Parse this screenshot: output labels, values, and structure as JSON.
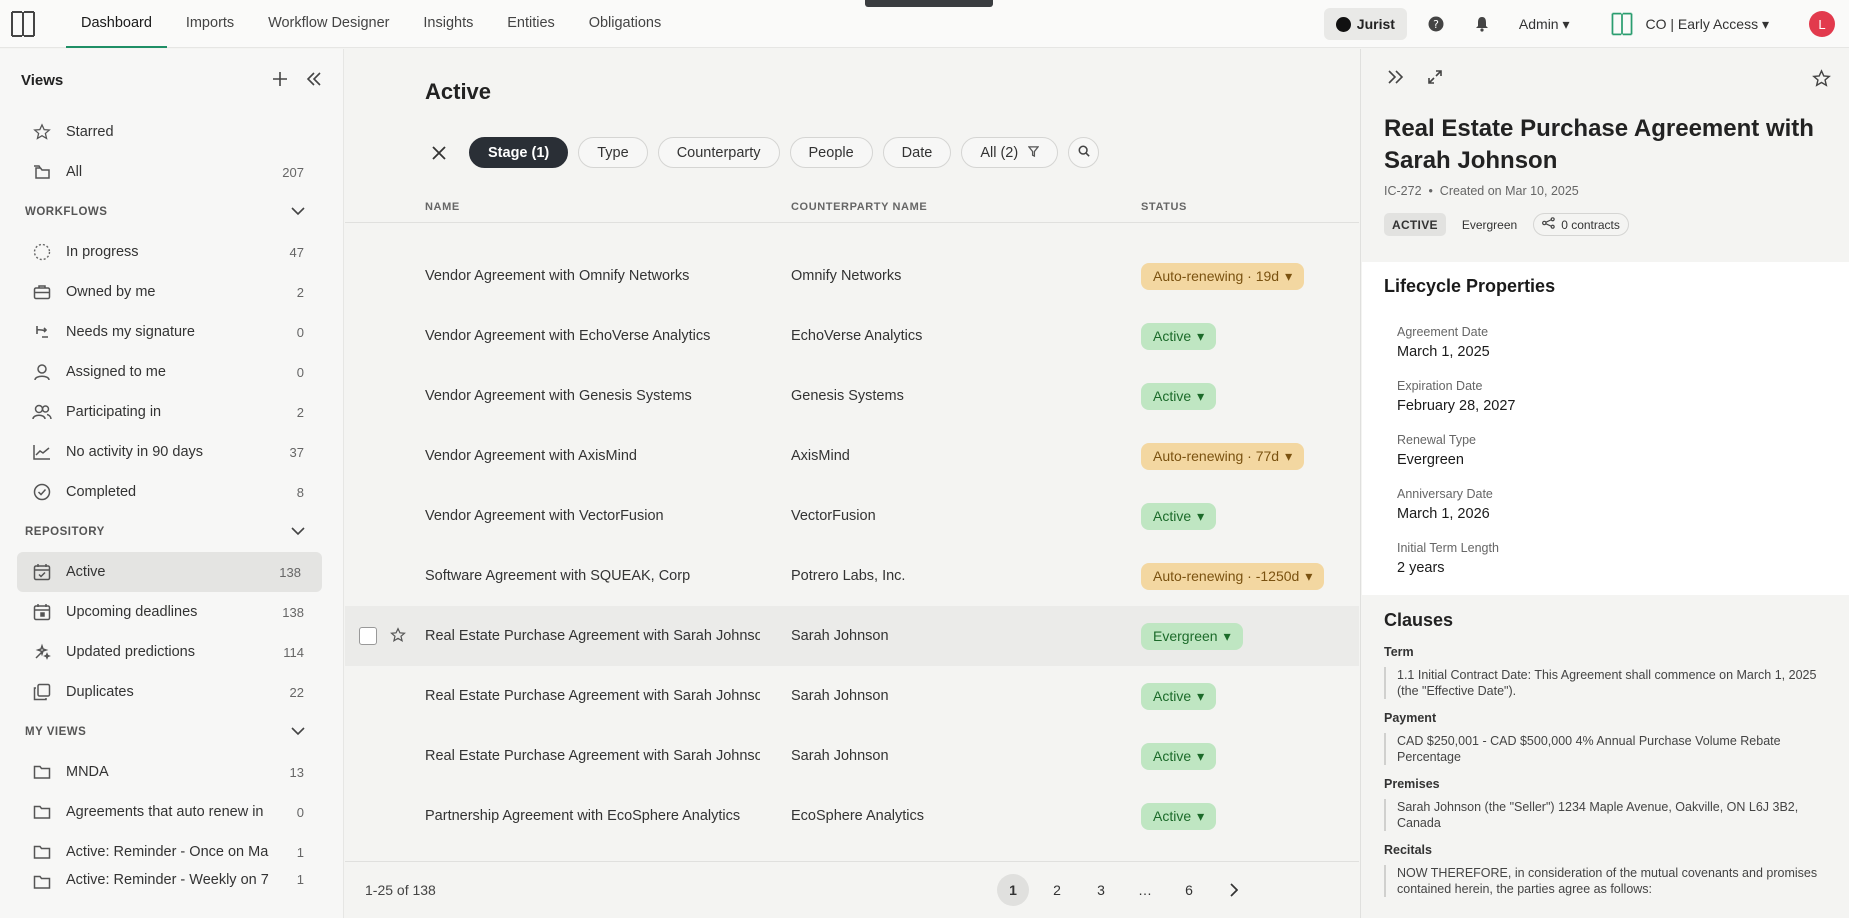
{
  "nav": {
    "items": [
      "Dashboard",
      "Imports",
      "Workflow Designer",
      "Insights",
      "Entities",
      "Obligations"
    ],
    "active": "Dashboard"
  },
  "topright": {
    "jurist": "Jurist",
    "admin": "Admin ▾",
    "org": "CO | Early Access ▾",
    "avatar": "L"
  },
  "sidebar": {
    "title": "Views",
    "top": [
      {
        "label": "Starred",
        "count": ""
      },
      {
        "label": "All",
        "count": "207"
      }
    ],
    "workflows_label": "WORKFLOWS",
    "workflows": [
      {
        "label": "In progress",
        "count": "47"
      },
      {
        "label": "Owned by me",
        "count": "2"
      },
      {
        "label": "Needs my signature",
        "count": "0"
      },
      {
        "label": "Assigned to me",
        "count": "0"
      },
      {
        "label": "Participating in",
        "count": "2"
      },
      {
        "label": "No activity in 90 days",
        "count": "37"
      },
      {
        "label": "Completed",
        "count": "8"
      }
    ],
    "repository_label": "REPOSITORY",
    "repository": [
      {
        "label": "Active",
        "count": "138"
      },
      {
        "label": "Upcoming deadlines",
        "count": "138"
      },
      {
        "label": "Updated predictions",
        "count": "114"
      },
      {
        "label": "Duplicates",
        "count": "22"
      }
    ],
    "myviews_label": "MY VIEWS",
    "myviews": [
      {
        "label": "MNDA",
        "count": "13"
      },
      {
        "label": "Agreements that auto renew in",
        "count": "0"
      },
      {
        "label": "Active: Reminder - Once on Ma",
        "count": "1"
      },
      {
        "label": "Active: Reminder - Weekly on 7",
        "count": "1"
      }
    ]
  },
  "main": {
    "title": "Active",
    "filters": [
      "Stage (1)",
      "Type",
      "Counterparty",
      "People",
      "Date",
      "All (2)"
    ],
    "columns": [
      "NAME",
      "COUNTERPARTY NAME",
      "STATUS"
    ],
    "rows": [
      {
        "name": "Vendor Agreement with Omnify Networks",
        "cp": "Omnify Networks",
        "status": "Auto-renewing · 19d",
        "tone": "amber"
      },
      {
        "name": "Vendor Agreement with EchoVerse Analytics",
        "cp": "EchoVerse Analytics",
        "status": "Active",
        "tone": "green"
      },
      {
        "name": "Vendor Agreement with Genesis Systems",
        "cp": "Genesis Systems",
        "status": "Active",
        "tone": "green"
      },
      {
        "name": "Vendor Agreement with AxisMind",
        "cp": "AxisMind",
        "status": "Auto-renewing · 77d",
        "tone": "amber"
      },
      {
        "name": "Vendor Agreement with VectorFusion",
        "cp": "VectorFusion",
        "status": "Active",
        "tone": "green"
      },
      {
        "name": "Software Agreement with SQUEAK, Corp",
        "cp": "Potrero Labs, Inc.",
        "status": "Auto-renewing · -1250d",
        "tone": "amber"
      },
      {
        "name": "Real Estate Purchase Agreement with Sarah Johnson",
        "cp": "Sarah Johnson",
        "status": "Evergreen",
        "tone": "green",
        "highlight": true
      },
      {
        "name": "Real Estate Purchase Agreement with Sarah Johnson",
        "cp": "Sarah Johnson",
        "status": "Active",
        "tone": "green"
      },
      {
        "name": "Real Estate Purchase Agreement with Sarah Johnson",
        "cp": "Sarah Johnson",
        "status": "Active",
        "tone": "green"
      },
      {
        "name": "Partnership Agreement with EcoSphere Analytics",
        "cp": "EcoSphere Analytics",
        "status": "Active",
        "tone": "green"
      }
    ],
    "pager": {
      "range": "1-25 of 138",
      "pages": [
        "1",
        "2",
        "3",
        "…",
        "6"
      ]
    }
  },
  "panel": {
    "title": "Real Estate Purchase Agreement with Sarah Johnson",
    "meta": "IC-272  •  Created on Mar 10, 2025",
    "tags": {
      "status": "ACTIVE",
      "renewal": "Evergreen",
      "contracts": "0 contracts"
    },
    "lifecycle_title": "Lifecycle Properties",
    "props": [
      {
        "label": "Agreement Date",
        "value": "March 1, 2025"
      },
      {
        "label": "Expiration Date",
        "value": "February 28, 2027"
      },
      {
        "label": "Renewal Type",
        "value": "Evergreen"
      },
      {
        "label": "Anniversary Date",
        "value": "March 1, 2026"
      },
      {
        "label": "Initial Term Length",
        "value": "2 years"
      }
    ],
    "clauses_title": "Clauses",
    "clauses": [
      {
        "head": "Term",
        "text": "1.1 Initial Contract Date: This Agreement shall commence on March 1, 2025 (the \"Effective Date\")."
      },
      {
        "head": "Payment",
        "text": "CAD $250,001 - CAD $500,000 4% Annual Purchase Volume Rebate Percentage"
      },
      {
        "head": "Premises",
        "text": "Sarah Johnson (the \"Seller\") 1234 Maple Avenue, Oakville, ON L6J 3B2, Canada"
      },
      {
        "head": "Recitals",
        "text": "NOW THEREFORE, in consideration of the mutual covenants and promises contained herein, the parties agree as follows:"
      }
    ]
  }
}
